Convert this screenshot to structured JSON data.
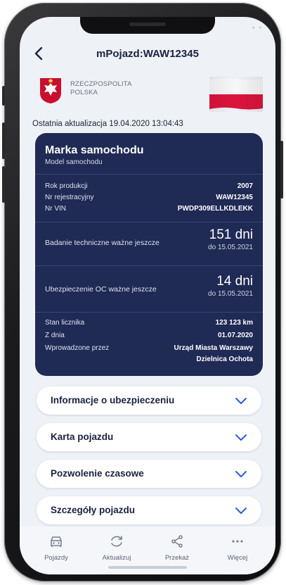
{
  "header": {
    "title": "mPojazd:WAW12345"
  },
  "issuer": {
    "line1": "RZECZPOSPOLITA",
    "line2": "POLSKA"
  },
  "updated": "Ostatnia aktualizacja 19.04.2020 13:04:43",
  "status_text": "▪ ▪",
  "card": {
    "brand": "Marka samochodu",
    "model": "Model samochodu",
    "rows1": [
      {
        "label": "Rok produkcji",
        "value": "2007"
      },
      {
        "label": "Nr rejestracyjny",
        "value": "WAW12345"
      },
      {
        "label": "Nr VIN",
        "value": "PWDP309ELLKDLEKK"
      }
    ],
    "inspection": {
      "label": "Badanie techniczne ważne jeszcze",
      "value": "151 dni",
      "until": "do 15.05.2021"
    },
    "insurance": {
      "label": "Ubezpieczenie OC ważne jeszcze",
      "value": "14 dni",
      "until": "do 15.05.2021"
    },
    "rows2": [
      {
        "label": "Stan licznika",
        "value": "123 123 km"
      },
      {
        "label": "Z dnia",
        "value": "01.07.2020"
      },
      {
        "label": "Wprowadzone przez",
        "value": "Urząd Miasta Warszawy"
      }
    ],
    "entered_by_line2": "Dzielnica Ochota"
  },
  "sections": [
    {
      "label": "Informacje o ubezpieczeniu"
    },
    {
      "label": "Karta pojazdu"
    },
    {
      "label": "Pozwolenie czasowe"
    },
    {
      "label": "Szczegóły pojazdu"
    }
  ],
  "nav": [
    {
      "label": "Pojazdy",
      "icon": "car-icon"
    },
    {
      "label": "Aktualizuj",
      "icon": "refresh-icon"
    },
    {
      "label": "Przekaż",
      "icon": "share-icon"
    },
    {
      "label": "Więcej",
      "icon": "more-icon"
    }
  ],
  "colors": {
    "card_bg": "#1f2a55",
    "accent": "#2e5bd6",
    "flag_red": "#dc143c"
  }
}
